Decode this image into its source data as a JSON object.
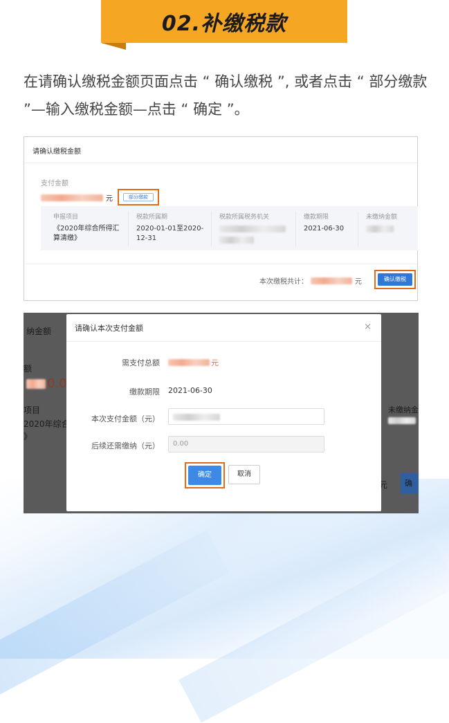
{
  "header": {
    "section_title": "02.补缴税款",
    "accent_color": "#f5a623"
  },
  "intro": {
    "text": "在请确认缴税金额页面点击 “ 确认缴税 ”, 或者点击 “ 部分缴款 ”—输入缴税金额—点击 “ 确定 ”。"
  },
  "screenshot1": {
    "title": "请确认缴税金额",
    "pay_amount_label": "支付金额",
    "currency_unit": "元",
    "partial_pay_button": "部分缴款",
    "columns": [
      "申报项目",
      "税款所属期",
      "税款所属税务机关",
      "缴款期限",
      "未缴纳金额"
    ],
    "row": {
      "project": "《2020年综合所得汇算清缴》",
      "period": "2020-01-01至2020-12-31",
      "deadline": "2021-06-30"
    },
    "total_label": "本次缴税共计：",
    "confirm_button": "确认缴税",
    "highlight_color": "#e06c1a"
  },
  "screenshot2": {
    "background_fragments": {
      "left_title": "纳金额",
      "left_e": "额",
      "left_amount": "0.0",
      "left_item": "项目",
      "left_item2": "2020年综合所",
      "left_item3": "》",
      "right_unpaid": "未缴纳金",
      "right_yuan": "元",
      "right_btn": "确"
    },
    "modal": {
      "title": "请确认本次支付金额",
      "close_icon": "×",
      "fields": [
        {
          "label": "需支付总额",
          "value": "元"
        },
        {
          "label": "缴款期限",
          "value": "2021-06-30"
        },
        {
          "label": "本次支付金额（元）",
          "value": ""
        },
        {
          "label": "后续还需缴纳（元）",
          "value": "0.00"
        }
      ],
      "ok_button": "确定",
      "cancel_button": "取消"
    }
  }
}
